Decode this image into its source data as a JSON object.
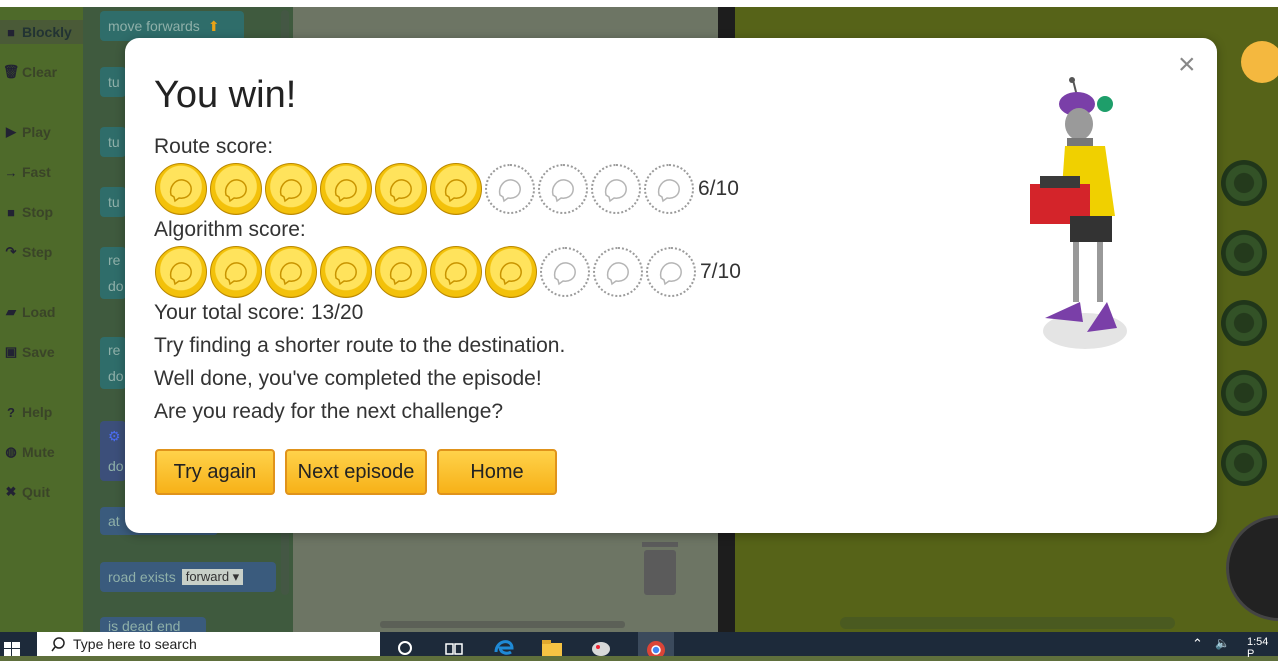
{
  "menu": {
    "items": [
      {
        "label": "Blockly",
        "icon": "blockly-icon"
      },
      {
        "label": "Clear",
        "icon": "trash-icon"
      },
      {
        "label": "Play",
        "icon": "play-icon"
      },
      {
        "label": "Fast",
        "icon": "fast-icon"
      },
      {
        "label": "Stop",
        "icon": "stop-icon"
      },
      {
        "label": "Step",
        "icon": "step-icon"
      },
      {
        "label": "Load",
        "icon": "folder-icon"
      },
      {
        "label": "Save",
        "icon": "save-icon"
      },
      {
        "label": "Help",
        "icon": "help-icon"
      },
      {
        "label": "Mute",
        "icon": "speaker-icon"
      },
      {
        "label": "Quit",
        "icon": "close-icon"
      }
    ]
  },
  "toolbox": {
    "blocks": [
      "move forwards",
      "tu",
      "tu",
      "tu",
      "re",
      "do",
      "re",
      "do",
      "do",
      "at",
      "road exists",
      "is dead end"
    ],
    "road_exists_option": "forward"
  },
  "modal": {
    "title": "You win!",
    "route_label": "Route score:",
    "route_score": 6,
    "route_max": 10,
    "route_value": "6/10",
    "algorithm_label": "Algorithm score:",
    "algorithm_score": 7,
    "algorithm_max": 10,
    "algorithm_value": "7/10",
    "total": "Your total score: 13/20",
    "message1": "Try finding a shorter route to the destination.",
    "message2": "Well done, you've completed the episode!",
    "message3": "Are you ready for the next challenge?",
    "buttons": {
      "try_again": "Try again",
      "next_episode": "Next episode",
      "home": "Home"
    },
    "close_label": "×"
  },
  "taskbar": {
    "search_placeholder": "Type here to search",
    "time": "1:54 P"
  },
  "colors": {
    "button": "#f7b118",
    "coin_gold": "#f3c10a",
    "game_bg": "#566318"
  }
}
